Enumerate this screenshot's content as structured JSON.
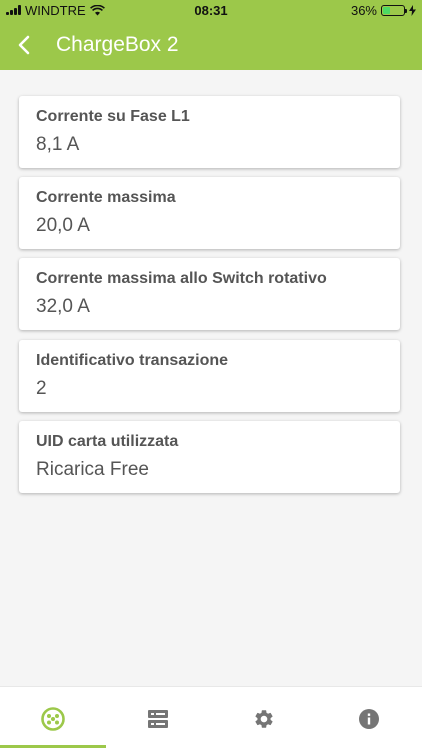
{
  "status_bar": {
    "carrier": "WINDTRE",
    "time": "08:31",
    "battery": "36%",
    "battery_level": 0.36
  },
  "header": {
    "title": "ChargeBox 2"
  },
  "cards": [
    {
      "label": "Corrente su Fase L1",
      "value": "8,1 A"
    },
    {
      "label": "Corrente massima",
      "value": "20,0 A"
    },
    {
      "label": "Corrente massima allo Switch rotativo",
      "value": "32,0 A"
    },
    {
      "label": "Identificativo transazione",
      "value": "2"
    },
    {
      "label": "UID carta utilizzata",
      "value": "Ricarica Free"
    }
  ],
  "bottom_nav": [
    {
      "icon": "connector-icon",
      "active": true
    },
    {
      "icon": "server-icon",
      "active": false
    },
    {
      "icon": "gear-icon",
      "active": false
    },
    {
      "icon": "info-icon",
      "active": false
    }
  ],
  "colors": {
    "accent": "#9cc84a",
    "inactive_icon": "#757575"
  }
}
